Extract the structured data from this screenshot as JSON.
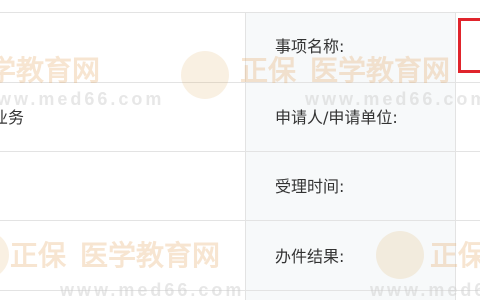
{
  "rows": [
    {
      "label": "事项名称:",
      "value": ""
    },
    {
      "label": "申请人/申请单位:",
      "value": "业务"
    },
    {
      "label": "受理时间:",
      "value": ""
    },
    {
      "label": "办件结果:",
      "value": ""
    }
  ],
  "watermark": {
    "brand": "正保",
    "text": "医学教育网",
    "url": "www.med66.com"
  },
  "colors": {
    "highlight_border": "#e0242c",
    "grid": "#e3e3e3",
    "label_bg": "#f7f9fa"
  }
}
